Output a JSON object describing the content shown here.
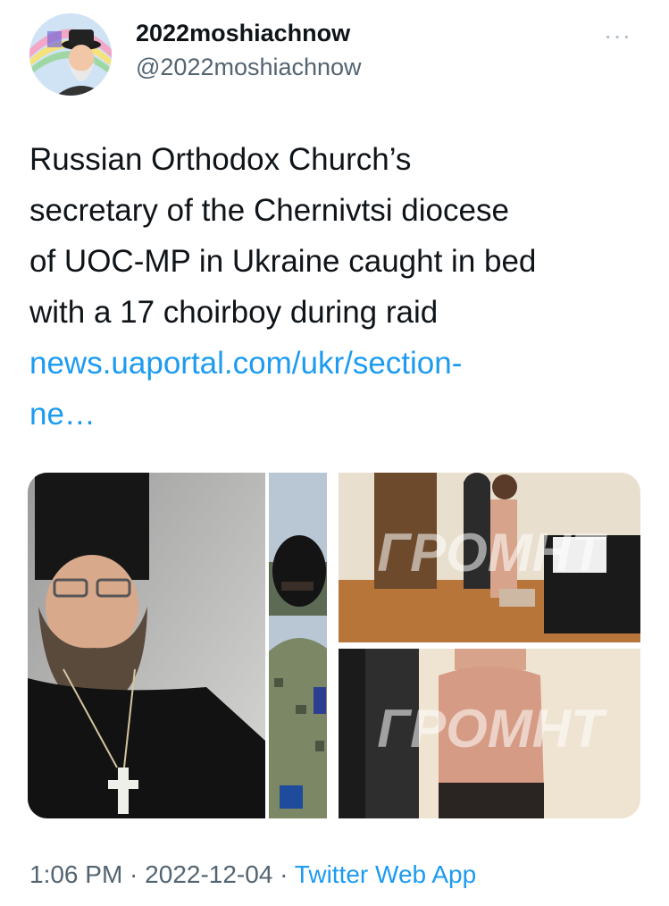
{
  "user": {
    "display_name": "2022moshiachnow",
    "handle": "@2022moshiachnow"
  },
  "more_icon": "more-dots-icon",
  "tweet": {
    "text_lines": [
      "Russian Orthodox Church’s",
      "secretary of the Chernivtsi diocese",
      "of UOC-MP in Ukraine caught in bed",
      "with a 17 choirboy during raid"
    ],
    "link_line1": "news.uaportal.com/ukr/section-",
    "link_line2": "ne…"
  },
  "media": {
    "watermark": "ГРОМНТ",
    "images": [
      "priest-photo",
      "masked-officer-photo",
      "raid-room-photo",
      "raid-wall-photo"
    ]
  },
  "meta": {
    "time": "1:06 PM",
    "separator": " · ",
    "date": "2022-12-04",
    "source": "Twitter Web App"
  },
  "colors": {
    "text": "#0f1419",
    "secondary": "#536471",
    "link": "#1d9bf0"
  }
}
